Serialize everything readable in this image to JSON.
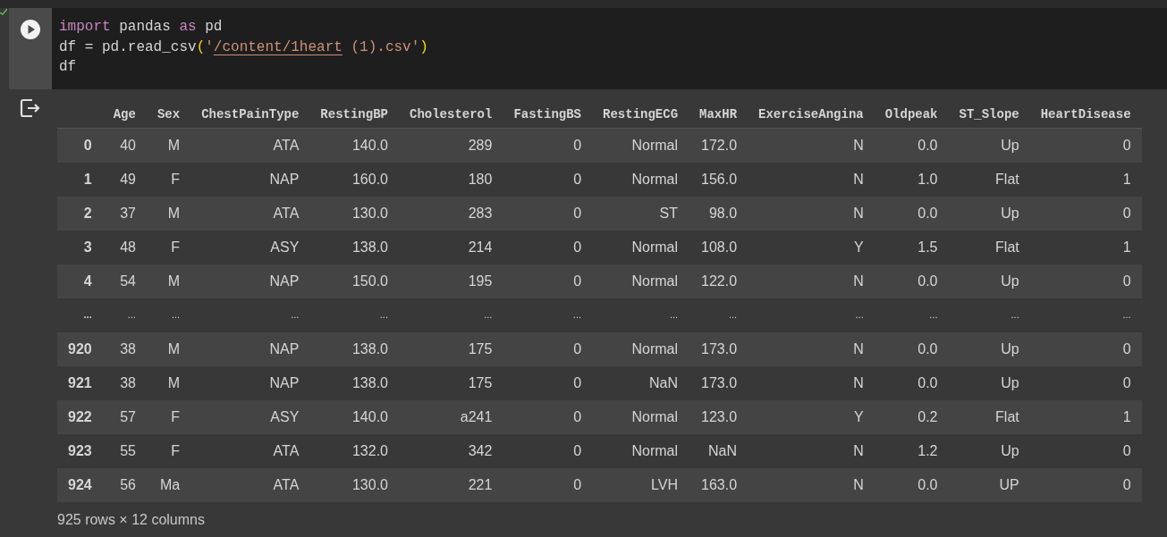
{
  "cell": {
    "executed": true,
    "code": [
      [
        {
          "text": "import",
          "kind": "keyword"
        },
        {
          "text": " pandas ",
          "kind": "plain"
        },
        {
          "text": "as",
          "kind": "keyword"
        },
        {
          "text": " pd",
          "kind": "plain"
        }
      ],
      [
        {
          "text": "df = pd.read_csv",
          "kind": "plain"
        },
        {
          "text": "(",
          "kind": "bracket"
        },
        {
          "text": "'",
          "kind": "string"
        },
        {
          "text": "/content/1heart",
          "kind": "flagged"
        },
        {
          "text": " (1).csv'",
          "kind": "string"
        },
        {
          "text": ")",
          "kind": "bracket"
        }
      ],
      [
        {
          "text": "df",
          "kind": "plain"
        }
      ]
    ]
  },
  "table": {
    "columns": [
      "Age",
      "Sex",
      "ChestPainType",
      "RestingBP",
      "Cholesterol",
      "FastingBS",
      "RestingECG",
      "MaxHR",
      "ExerciseAngina",
      "Oldpeak",
      "ST_Slope",
      "HeartDisease"
    ],
    "rows": [
      {
        "index": "0",
        "cells": [
          "40",
          "M",
          "ATA",
          "140.0",
          "289",
          "0",
          "Normal",
          "172.0",
          "N",
          "0.0",
          "Up",
          "0"
        ]
      },
      {
        "index": "1",
        "cells": [
          "49",
          "F",
          "NAP",
          "160.0",
          "180",
          "0",
          "Normal",
          "156.0",
          "N",
          "1.0",
          "Flat",
          "1"
        ]
      },
      {
        "index": "2",
        "cells": [
          "37",
          "M",
          "ATA",
          "130.0",
          "283",
          "0",
          "ST",
          "98.0",
          "N",
          "0.0",
          "Up",
          "0"
        ]
      },
      {
        "index": "3",
        "cells": [
          "48",
          "F",
          "ASY",
          "138.0",
          "214",
          "0",
          "Normal",
          "108.0",
          "Y",
          "1.5",
          "Flat",
          "1"
        ]
      },
      {
        "index": "4",
        "cells": [
          "54",
          "M",
          "NAP",
          "150.0",
          "195",
          "0",
          "Normal",
          "122.0",
          "N",
          "0.0",
          "Up",
          "0"
        ]
      },
      {
        "index": "...",
        "cells": [
          "...",
          "...",
          "...",
          "...",
          "...",
          "...",
          "...",
          "...",
          "...",
          "...",
          "...",
          "..."
        ]
      },
      {
        "index": "920",
        "cells": [
          "38",
          "M",
          "NAP",
          "138.0",
          "175",
          "0",
          "Normal",
          "173.0",
          "N",
          "0.0",
          "Up",
          "0"
        ]
      },
      {
        "index": "921",
        "cells": [
          "38",
          "M",
          "NAP",
          "138.0",
          "175",
          "0",
          "NaN",
          "173.0",
          "N",
          "0.0",
          "Up",
          "0"
        ]
      },
      {
        "index": "922",
        "cells": [
          "57",
          "F",
          "ASY",
          "140.0",
          "a241",
          "0",
          "Normal",
          "123.0",
          "Y",
          "0.2",
          "Flat",
          "1"
        ]
      },
      {
        "index": "923",
        "cells": [
          "55",
          "F",
          "ATA",
          "132.0",
          "342",
          "0",
          "Normal",
          "NaN",
          "N",
          "1.2",
          "Up",
          "0"
        ]
      },
      {
        "index": "924",
        "cells": [
          "56",
          "Ma",
          "ATA",
          "130.0",
          "221",
          "0",
          "LVH",
          "163.0",
          "N",
          "0.0",
          "UP",
          "0"
        ]
      }
    ],
    "summary": "925 rows × 12 columns"
  }
}
